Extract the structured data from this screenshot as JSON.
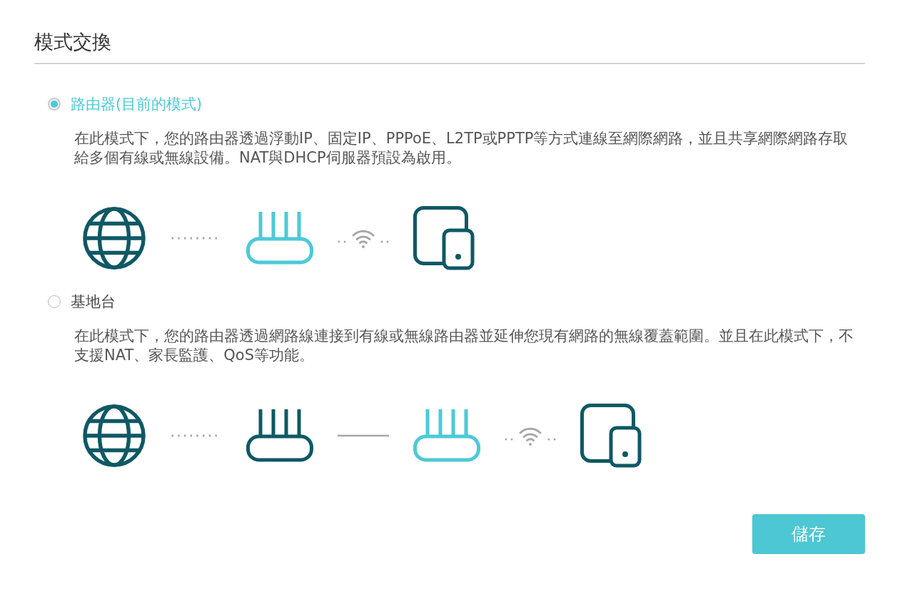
{
  "title": "模式交換",
  "modes": [
    {
      "label": "路由器(目前的模式)",
      "selected": true,
      "description": "在此模式下，您的路由器透過浮動IP、固定IP、PPPoE、L2TP或PPTP等方式連線至網際網路，並且共享網際網路存取給多個有線或無線設備。NAT與DHCP伺服器預設為啟用。"
    },
    {
      "label": "基地台",
      "selected": false,
      "description": "在此模式下，您的路由器透過網路線連接到有線或無線路由器並延伸您現有網路的無線覆蓋範圍。並且在此模式下，不支援NAT、家長監護、QoS等功能。"
    }
  ],
  "save_button": "儲存"
}
